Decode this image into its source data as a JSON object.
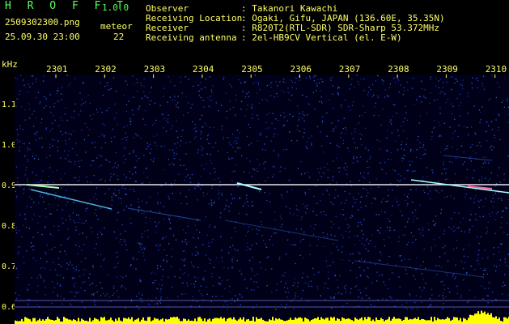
{
  "header": {
    "app_name": "H R O F F T",
    "version": "1.0.0",
    "file_name": "2509302300.png",
    "datetime": "25.09.30 23:00",
    "meteor_label": "meteor",
    "meteor_count": "22"
  },
  "info": {
    "observer_label": "Observer",
    "observer_value": ": Takanori Kawachi",
    "location_label": "Receiving Location",
    "location_value": ": Ogaki, Gifu, JAPAN (136.60E, 35.35N)",
    "receiver_label": "Receiver",
    "receiver_value": ": R820T2(RTL-SDR) SDR-Sharp 53.372MHz",
    "antenna_label": "Receiving antenna",
    "antenna_value": ": 2el-HB9CV Vertical (el. E-W)"
  },
  "axis": {
    "unit": "kHz",
    "x_ticks": [
      "2301",
      "2302",
      "2303",
      "2304",
      "2305",
      "2306",
      "2307",
      "2308",
      "2309",
      "2310"
    ],
    "y_ticks": [
      "1.1",
      "1.0",
      "0.9",
      "0.8",
      "0.7",
      "0.6"
    ]
  },
  "colors": {
    "background": "#000010",
    "text_green": "#5dff5d",
    "text_yellow": "#ffff66",
    "carrier": "#ffffff",
    "meteor_trail": "#aaffff",
    "noise_floor": "#ffff00"
  }
}
